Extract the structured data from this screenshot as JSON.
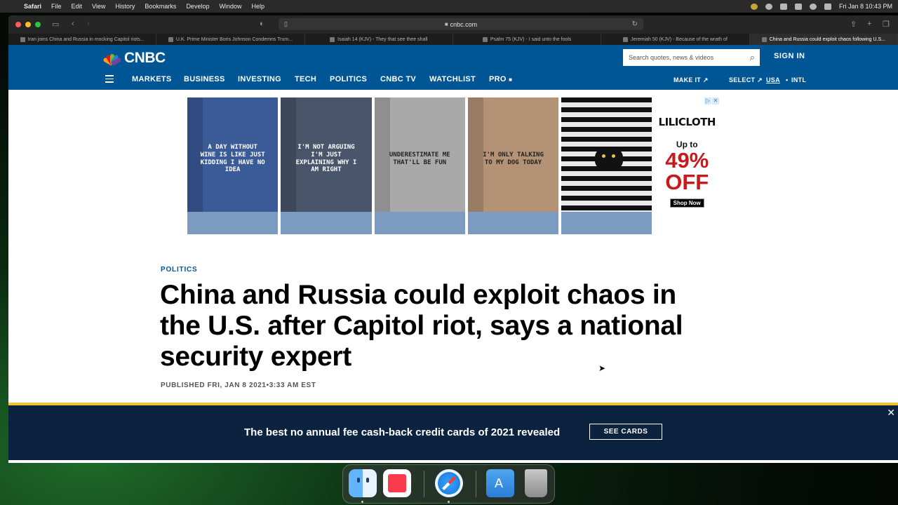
{
  "menubar": {
    "app": "Safari",
    "items": [
      "File",
      "Edit",
      "View",
      "History",
      "Bookmarks",
      "Develop",
      "Window",
      "Help"
    ],
    "clock": "Fri Jan 8  10:43 PM"
  },
  "browser": {
    "url": "cnbc.com",
    "tabs": [
      {
        "label": "Iran joins China and Russia in mocking Capitol riots..."
      },
      {
        "label": "U.K. Prime Minister Boris Johnson Condemns Trum..."
      },
      {
        "label": "Isaiah 14 (KJV) - They that see thee shall"
      },
      {
        "label": "Psalm 75 (KJV) - I said unto the fools"
      },
      {
        "label": "Jeremiah 50 (KJV) - Because of the wrath of"
      },
      {
        "label": "China and Russia could exploit chaos following U.S..."
      }
    ]
  },
  "header": {
    "logo": "CNBC",
    "search_placeholder": "Search quotes, news & videos",
    "sign_in": "SIGN IN",
    "nav": [
      "MARKETS",
      "BUSINESS",
      "INVESTING",
      "TECH",
      "POLITICS",
      "CNBC TV",
      "WATCHLIST",
      "PRO"
    ],
    "right_nav": [
      "MAKE IT",
      "SELECT",
      "USA",
      "INTL"
    ]
  },
  "ad": {
    "shirts": [
      "A DAY WITHOUT WINE IS LIKE JUST KIDDING I HAVE NO IDEA",
      "I'M NOT ARGUING I'M JUST EXPLAINING WHY I AM RIGHT",
      "UNDERESTIMATE ME THAT'LL BE FUN",
      "I'M ONLY TALKING TO MY DOG TODAY",
      ""
    ],
    "brand": "LILICLOTH",
    "up_to": "Up to",
    "percent": "49%",
    "off": "OFF",
    "cta": "Shop Now"
  },
  "article": {
    "section": "POLITICS",
    "headline": "China and Russia could exploit chaos in the U.S. after Capitol riot, says a national security expert",
    "published": "PUBLISHED FRI, JAN 8 2021•3:33 AM EST"
  },
  "banner": {
    "text": "The best no annual fee cash-back credit cards of 2021 revealed",
    "button": "SEE CARDS"
  },
  "colors": {
    "cnbc_blue": "#005594",
    "banner_navy": "#0c2340",
    "banner_accent": "#f2c12e",
    "sale_red": "#c8191c"
  }
}
